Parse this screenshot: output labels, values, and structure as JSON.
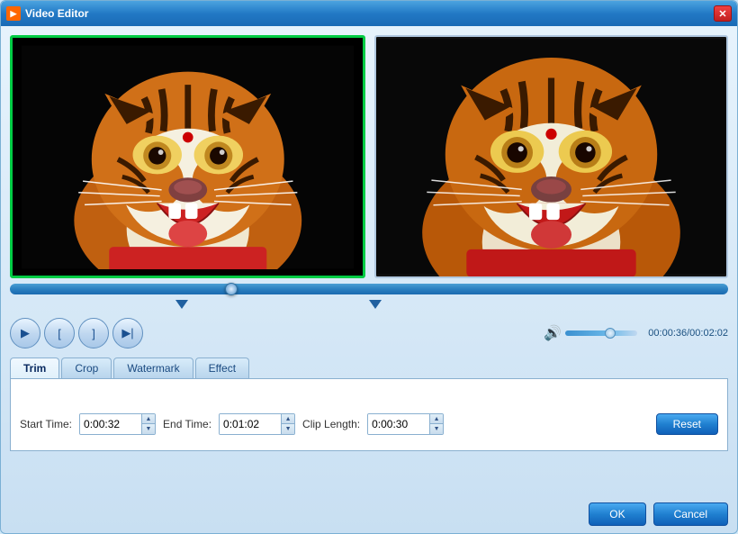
{
  "window": {
    "title": "Video Editor",
    "icon": "▶"
  },
  "titlebar": {
    "close_btn": "✕"
  },
  "controls": {
    "play": "▶",
    "mark_in": "[",
    "mark_out": "]",
    "step_forward": "▶|"
  },
  "time": {
    "current": "00:00:36",
    "total": "00:02:02",
    "display": "00:00:36/00:02:02"
  },
  "tabs": [
    {
      "id": "trim",
      "label": "Trim",
      "active": true
    },
    {
      "id": "crop",
      "label": "Crop",
      "active": false
    },
    {
      "id": "watermark",
      "label": "Watermark",
      "active": false
    },
    {
      "id": "effect",
      "label": "Effect",
      "active": false
    }
  ],
  "trim": {
    "start_label": "Start Time:",
    "start_value": "0:00:32",
    "end_label": "End Time:",
    "end_value": "0:01:02",
    "clip_label": "Clip Length:",
    "clip_value": "0:00:30",
    "reset_label": "Reset"
  },
  "buttons": {
    "ok": "OK",
    "cancel": "Cancel"
  }
}
